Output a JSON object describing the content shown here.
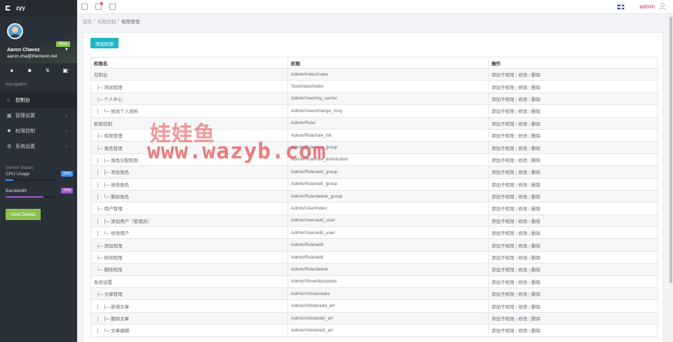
{
  "app": {
    "name": "zyy"
  },
  "profile": {
    "badge": "New",
    "name": "Aaron Chavez",
    "email": "aaron.cha@themeon.net"
  },
  "quick_icons": [
    "user-icon",
    "chat-icon",
    "bolt-icon",
    "lock-icon"
  ],
  "navigation": {
    "heading": "Navigation",
    "items": [
      {
        "label": "控制台",
        "icon": "home-icon",
        "active": true,
        "has_children": false
      },
      {
        "label": "管理设置",
        "icon": "grid-icon",
        "active": false,
        "has_children": true
      },
      {
        "label": "权限控制",
        "icon": "gear-icon",
        "active": false,
        "has_children": true
      },
      {
        "label": "系统设置",
        "icon": "cog-icon",
        "active": false,
        "has_children": true
      }
    ]
  },
  "server_status": {
    "heading": "Server Status",
    "cpu": {
      "label": "CPU Usage",
      "value": "15%",
      "fraction": 0.15,
      "color": "#3e8ef7"
    },
    "bandwidth": {
      "label": "Bandwidth",
      "value": "75%",
      "fraction": 0.75,
      "color": "#a05cc8"
    },
    "button": "View Details"
  },
  "topbar": {
    "user": "admin",
    "accent": "#c0346a"
  },
  "breadcrumb": [
    "首页",
    "权限控制",
    "权限管理"
  ],
  "panel": {
    "add_button": "添加权限",
    "columns": [
      "权限名",
      "权限",
      "操作"
    ],
    "ops": [
      "添加子权限",
      "修改",
      "删除"
    ],
    "rows": [
      {
        "name": "控制台",
        "rule": "Admin/Index/index"
      },
      {
        "name": "  ├─ 测试权限",
        "rule": "Test/index/index"
      },
      {
        "name": "  ├─ 个人中心",
        "rule": "Admin/User/my_center"
      },
      {
        "name": "  │   └─ 修改个人资料",
        "rule": "Admin/User/change_msg"
      },
      {
        "name": "权限控制",
        "rule": "Admin/Rule/"
      },
      {
        "name": "  ├─ 权限管理",
        "rule": "Admin/Rule/rule_list"
      },
      {
        "name": "  ├─ 角色管理",
        "rule": "Admin/Rule/rule_group"
      },
      {
        "name": "  │   ├─ 角色分配权限",
        "rule": "Admin/Rule/rule_distribution"
      },
      {
        "name": "  │   ├─ 添加角色",
        "rule": "Admin/Rule/add_group"
      },
      {
        "name": "  │   ├─ 修改角色",
        "rule": "Admin/Rule/edit_group"
      },
      {
        "name": "  │   └─ 删除角色",
        "rule": "Admin/Rule/delete_group"
      },
      {
        "name": "  ├─ 用户管理",
        "rule": "Admin/User/index"
      },
      {
        "name": "  │   ├─ 添加用户（管理员）",
        "rule": "Admin/User/add_user"
      },
      {
        "name": "  │   └─ 修改用户",
        "rule": "Admin/User/edit_user"
      },
      {
        "name": "  ├─ 添加权限",
        "rule": "Admin/Rule/add"
      },
      {
        "name": "  ├─ 修改权限",
        "rule": "Admin/Rule/edit"
      },
      {
        "name": "  └─ 删除权限",
        "rule": "Admin/Rule/delete"
      },
      {
        "name": "系统设置",
        "rule": "Admin/ShowNav/posts"
      },
      {
        "name": "  ├─ 文章管理",
        "rule": "Admin/Article/index"
      },
      {
        "name": "  │   ├─ 新增文章",
        "rule": "Admin/Article/add_art"
      },
      {
        "name": "  │   ├─ 删除文章",
        "rule": "Admin/Article/del_art"
      },
      {
        "name": "  │   └─ 文章编辑",
        "rule": "Admin/Article/edi_art"
      }
    ]
  },
  "watermark": {
    "cn": "娃娃鱼",
    "url": "www.wazyb.com"
  }
}
